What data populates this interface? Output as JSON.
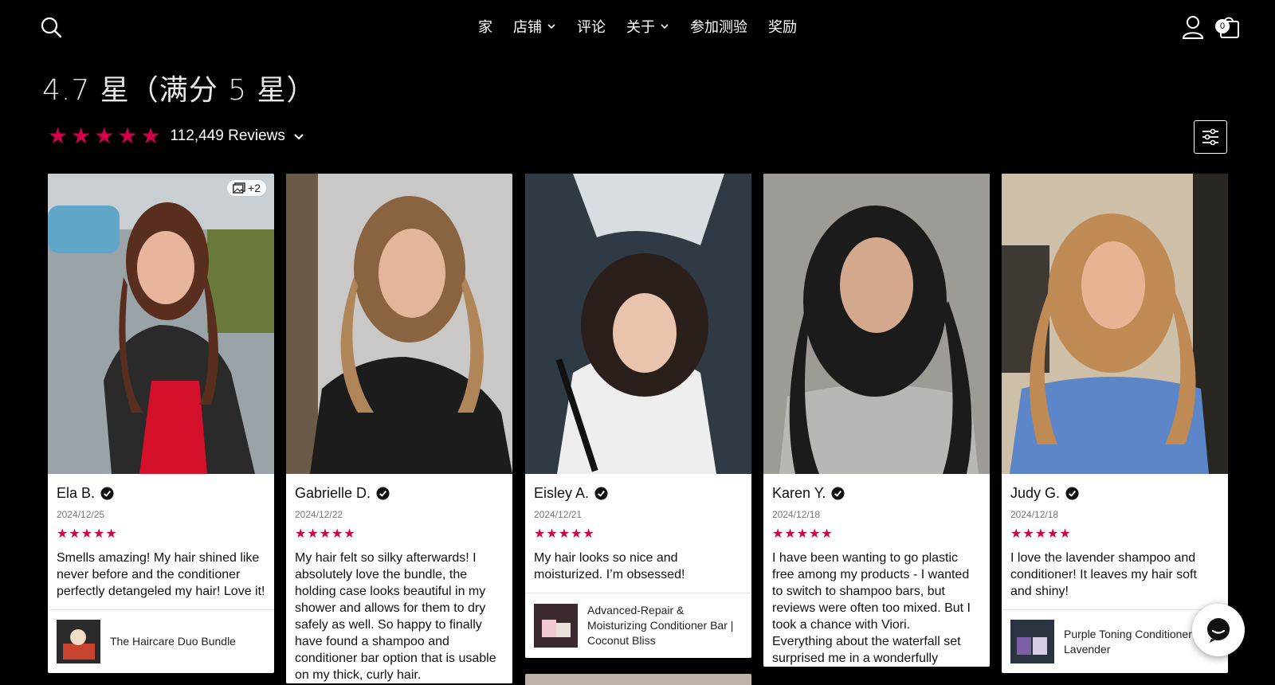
{
  "header": {
    "nav": [
      {
        "label": "家",
        "has_dropdown": false
      },
      {
        "label": "店铺",
        "has_dropdown": true
      },
      {
        "label": "评论",
        "has_dropdown": false
      },
      {
        "label": "关于",
        "has_dropdown": true
      },
      {
        "label": "参加测验",
        "has_dropdown": false
      },
      {
        "label": "奖励",
        "has_dropdown": false
      }
    ],
    "cart_count": "0",
    "icons": [
      "search-icon",
      "account-icon",
      "cart-icon"
    ]
  },
  "rating": {
    "title": "4.7 星（满分 5 星）",
    "review_count": "112,449 Reviews",
    "stars": 5,
    "star_color": "#d1004b"
  },
  "reviews": [
    {
      "name": "Ela B.",
      "date": "2024/12/25",
      "stars": 5,
      "photo_badge": "+2",
      "text": "Smells amazing! My hair shined like never before and the conditioner perfectly detangeled my hair! Love it!",
      "product": "The Haircare Duo Bundle"
    },
    {
      "name": "Gabrielle D.",
      "date": "2024/12/22",
      "stars": 5,
      "text": "My hair felt so silky afterwards! I absolutely love the bundle, the holding case looks beautiful in my shower and allows for them to dry safely as well. So happy to finally have found a shampoo and conditioner bar option that is usable on my thick, curly hair."
    },
    {
      "name": "Eisley A.",
      "date": "2024/12/21",
      "stars": 5,
      "text": "My hair looks so nice and moisturized. I’m obsessed!",
      "product": "Advanced-Repair & Moisturizing Conditioner Bar | Coconut Bliss"
    },
    {
      "name": "Karen Y.",
      "date": "2024/12/18",
      "stars": 5,
      "text": "I have been wanting to go plastic free among my products - I wanted to switch to shampoo bars, but reviews were often too mixed. But I took a chance with Viori.",
      "text_2": "Everything about the waterfall set surprised me in a wonderfully"
    },
    {
      "name": "Judy G.",
      "date": "2024/12/18",
      "stars": 5,
      "text": "I love the lavender shampoo and conditioner! It leaves my hair soft and shiny!",
      "product": "Purple Toning Conditioner Bar | Lavender"
    }
  ],
  "colors": {
    "background": "#000000",
    "accent": "#d1004b",
    "card": "#ffffff"
  }
}
